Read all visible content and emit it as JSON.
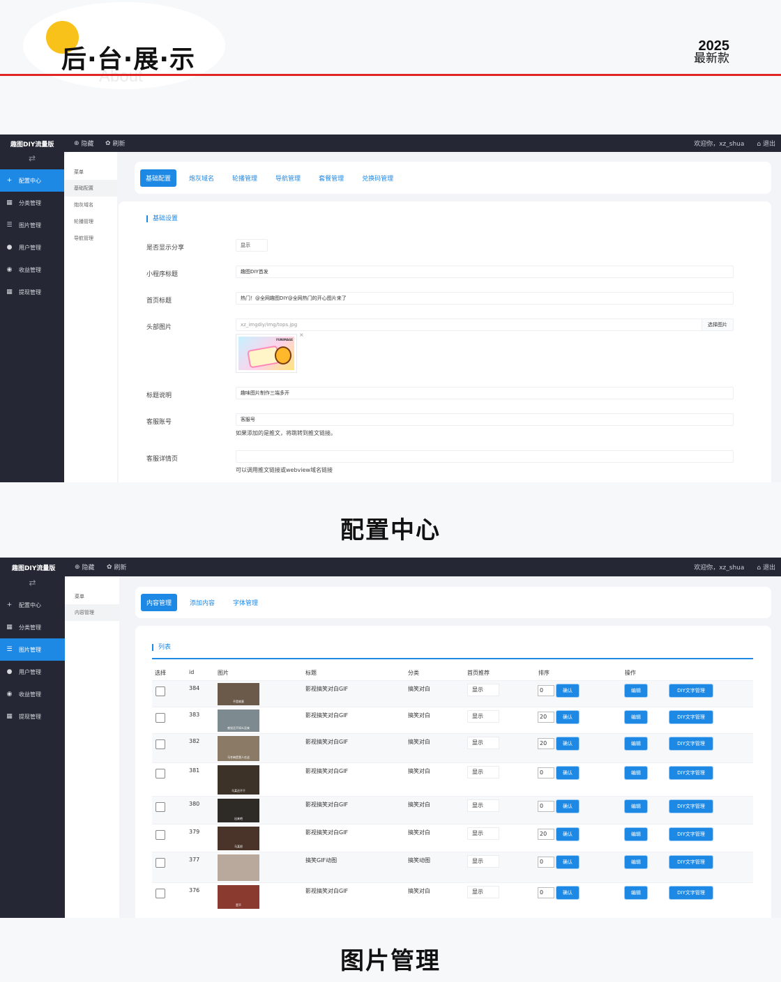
{
  "header": {
    "title": "后·台·展·示",
    "subtitle": "About",
    "year": "2025",
    "year_sub": "最新款"
  },
  "admin": {
    "brand": "趣图DIY流量版",
    "hide_label": "隐藏",
    "refresh_label": "刷新",
    "welcome": "欢迎你，xz_shua",
    "logout_label": "退出",
    "toggle": "⇄",
    "sidebar_items": [
      {
        "icon": "plus-icon",
        "label": "配置中心"
      },
      {
        "icon": "grid-icon",
        "label": "分类管理"
      },
      {
        "icon": "list-icon",
        "label": "图片管理"
      },
      {
        "icon": "user-icon",
        "label": "用户管理"
      },
      {
        "icon": "coin-icon",
        "label": "收益管理"
      },
      {
        "icon": "grid-icon",
        "label": "提现管理"
      }
    ]
  },
  "config": {
    "caption": "配置中心",
    "active_sidebar": 0,
    "submenu_head": "菜单",
    "submenu": [
      "基础配置",
      "炮灰域名",
      "轮播管理",
      "导航管理"
    ],
    "tabs": [
      "基础配置",
      "炮灰域名",
      "轮播管理",
      "导航管理",
      "套餐管理",
      "兑换码管理"
    ],
    "section_title": "基础设置",
    "form": {
      "share_label": "是否显示分享",
      "share_value": "显示",
      "mp_title_label": "小程序标题",
      "mp_title_value": "趣图DIY首发",
      "home_title_label": "首页标题",
      "home_title_value": "热门！@全网趣图DIY@全网热门的开心图片来了",
      "header_img_label": "头部图片",
      "header_img_path": "xz_imgdiy/img/tops.jpg",
      "pick_img": "选择图片",
      "thumb_logo": "FUNIMAGE",
      "thumb_close": "×",
      "desc_label": "标题说明",
      "desc_value": "趣味图片制作三端多开",
      "service_label": "客服账号",
      "service_value": "客服号",
      "service_hint": "如果添加的是推文，将跳转到推文链接。",
      "detail_label": "客服详情页",
      "detail_value": "",
      "detail_hint": "可以调用推文链接或webview域名链接"
    }
  },
  "images": {
    "caption": "图片管理",
    "active_sidebar": 2,
    "submenu_head": "菜单",
    "submenu": [
      "内容管理"
    ],
    "tabs": [
      "内容管理",
      "添加内容",
      "字体管理"
    ],
    "section_title": "列表",
    "columns": [
      "选择",
      "id",
      "图片",
      "标题",
      "分类",
      "首页推荐",
      "排序",
      "操作"
    ],
    "confirm_label": "确认",
    "edit_label": "编辑",
    "diy_label": "DIY文字管理",
    "rows": [
      {
        "id": "384",
        "title": "影视搞笑对白GIF",
        "category": "搞笑对白",
        "recommend": "显示",
        "sort": "0",
        "caption": "不是故意",
        "tone": "#6b5a4a"
      },
      {
        "id": "383",
        "title": "影视搞笑对白GIF",
        "category": "搞笑对白",
        "recommend": "显示",
        "sort": "20",
        "caption": "感觉还不如么没来",
        "tone": "#7d8a8f"
      },
      {
        "id": "382",
        "title": "影视搞笑对白GIF",
        "category": "搞笑对白",
        "recommend": "显示",
        "sort": "20",
        "caption": "马冬梅是我人在这",
        "tone": "#8a7a66"
      },
      {
        "id": "381",
        "title": "影视搞笑对白GIF",
        "category": "搞笑对白",
        "recommend": "显示",
        "sort": "0",
        "caption": "马某还不干",
        "tone": "#3d3228"
      },
      {
        "id": "380",
        "title": "影视搞笑对白GIF",
        "category": "搞笑对白",
        "recommend": "显示",
        "sort": "0",
        "caption": "出来吧",
        "tone": "#2e2a26"
      },
      {
        "id": "379",
        "title": "影视搞笑对白GIF",
        "category": "搞笑对白",
        "recommend": "显示",
        "sort": "20",
        "caption": "马某很",
        "tone": "#4a3328"
      },
      {
        "id": "377",
        "title": "搞笑GIF动图",
        "category": "搞笑动图",
        "recommend": "显示",
        "sort": "0",
        "caption": "",
        "tone": "#b9a89c"
      },
      {
        "id": "376",
        "title": "影视搞笑对白GIF",
        "category": "搞笑对白",
        "recommend": "显示",
        "sort": "0",
        "caption": "是不",
        "tone": "#8a3a2e"
      }
    ]
  }
}
